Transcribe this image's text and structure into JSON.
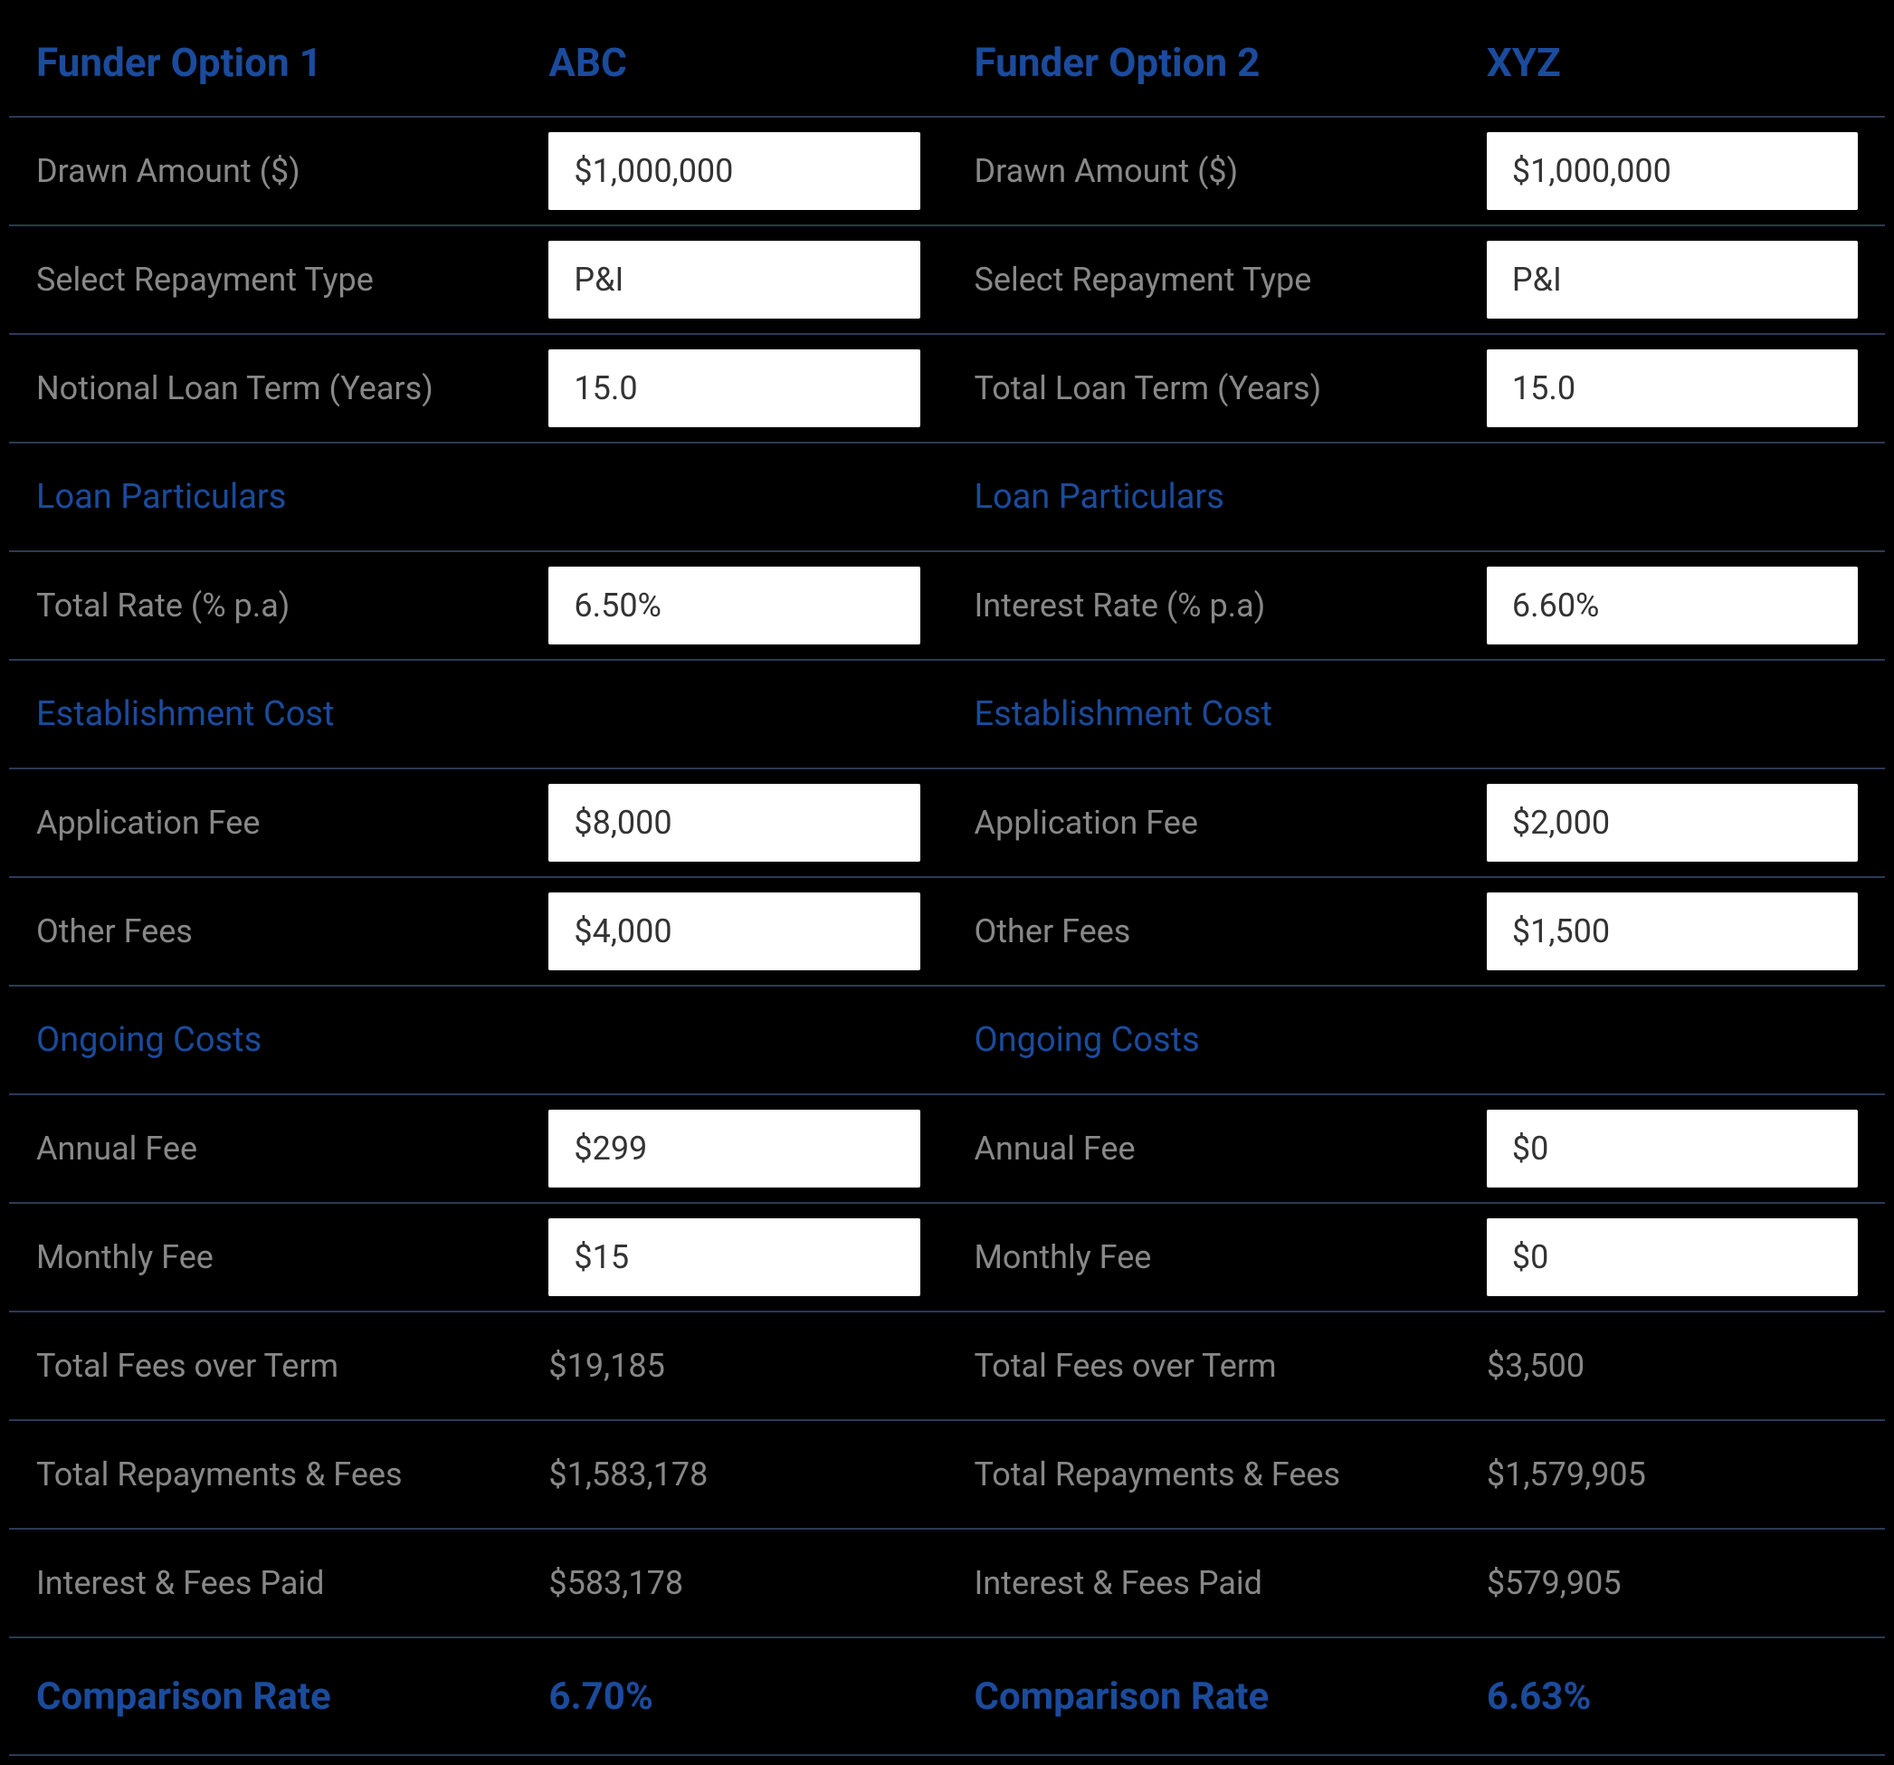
{
  "chart_data": {
    "type": "table",
    "title": "Funder Option Comparison",
    "options": [
      {
        "name": "ABC",
        "drawn_amount": 1000000,
        "repayment_type": "P&I",
        "loan_term_years": 15.0,
        "total_rate_pa": 6.5,
        "application_fee": 8000,
        "other_fees": 4000,
        "annual_fee": 299,
        "monthly_fee": 15,
        "total_fees_over_term": 19185,
        "total_repayments_and_fees": 1583178,
        "interest_and_fees_paid": 583178,
        "comparison_rate": 6.7
      },
      {
        "name": "XYZ",
        "drawn_amount": 1000000,
        "repayment_type": "P&I",
        "loan_term_years": 15.0,
        "interest_rate_pa": 6.6,
        "application_fee": 2000,
        "other_fees": 1500,
        "annual_fee": 0,
        "monthly_fee": 0,
        "total_fees_over_term": 3500,
        "total_repayments_and_fees": 1579905,
        "interest_and_fees_paid": 579905,
        "comparison_rate": 6.63
      }
    ]
  },
  "opt1": {
    "header_label": "Funder Option 1",
    "header_value": "ABC",
    "drawn_label": "Drawn Amount ($)",
    "drawn_value": "$1,000,000",
    "repay_label": "Select Repayment Type",
    "repay_value": "P&I",
    "term_label": "Notional Loan Term (Years)",
    "term_value": "15.0",
    "sec_particulars": "Loan Particulars",
    "rate_label": "Total Rate (% p.a)",
    "rate_value": "6.50%",
    "sec_establishment": "Establishment Cost",
    "appfee_label": "Application Fee",
    "appfee_value": "$8,000",
    "otherfee_label": "Other Fees",
    "otherfee_value": "$4,000",
    "sec_ongoing": "Ongoing Costs",
    "annual_label": "Annual Fee",
    "annual_value": "$299",
    "monthly_label": "Monthly Fee",
    "monthly_value": "$15",
    "totfees_label": "Total Fees over Term",
    "totfees_value": "$19,185",
    "totrepay_label": "Total Repayments & Fees",
    "totrepay_value": "$1,583,178",
    "intpaid_label": "Interest & Fees Paid",
    "intpaid_value": "$583,178",
    "comp_label": "Comparison Rate",
    "comp_value": "6.70%"
  },
  "opt2": {
    "header_label": "Funder Option 2",
    "header_value": "XYZ",
    "drawn_label": "Drawn Amount ($)",
    "drawn_value": "$1,000,000",
    "repay_label": "Select Repayment Type",
    "repay_value": "P&I",
    "term_label": "Total Loan Term (Years)",
    "term_value": "15.0",
    "sec_particulars": "Loan Particulars",
    "rate_label": "Interest Rate (% p.a)",
    "rate_value": "6.60%",
    "sec_establishment": "Establishment Cost",
    "appfee_label": "Application Fee",
    "appfee_value": "$2,000",
    "otherfee_label": "Other Fees",
    "otherfee_value": "$1,500",
    "sec_ongoing": "Ongoing Costs",
    "annual_label": "Annual Fee",
    "annual_value": "$0",
    "monthly_label": "Monthly Fee",
    "monthly_value": "$0",
    "totfees_label": "Total Fees over Term",
    "totfees_value": "$3,500",
    "totrepay_label": "Total Repayments & Fees",
    "totrepay_value": "$1,579,905",
    "intpaid_label": "Interest & Fees Paid",
    "intpaid_value": "$579,905",
    "comp_label": "Comparison Rate",
    "comp_value": "6.63%"
  }
}
